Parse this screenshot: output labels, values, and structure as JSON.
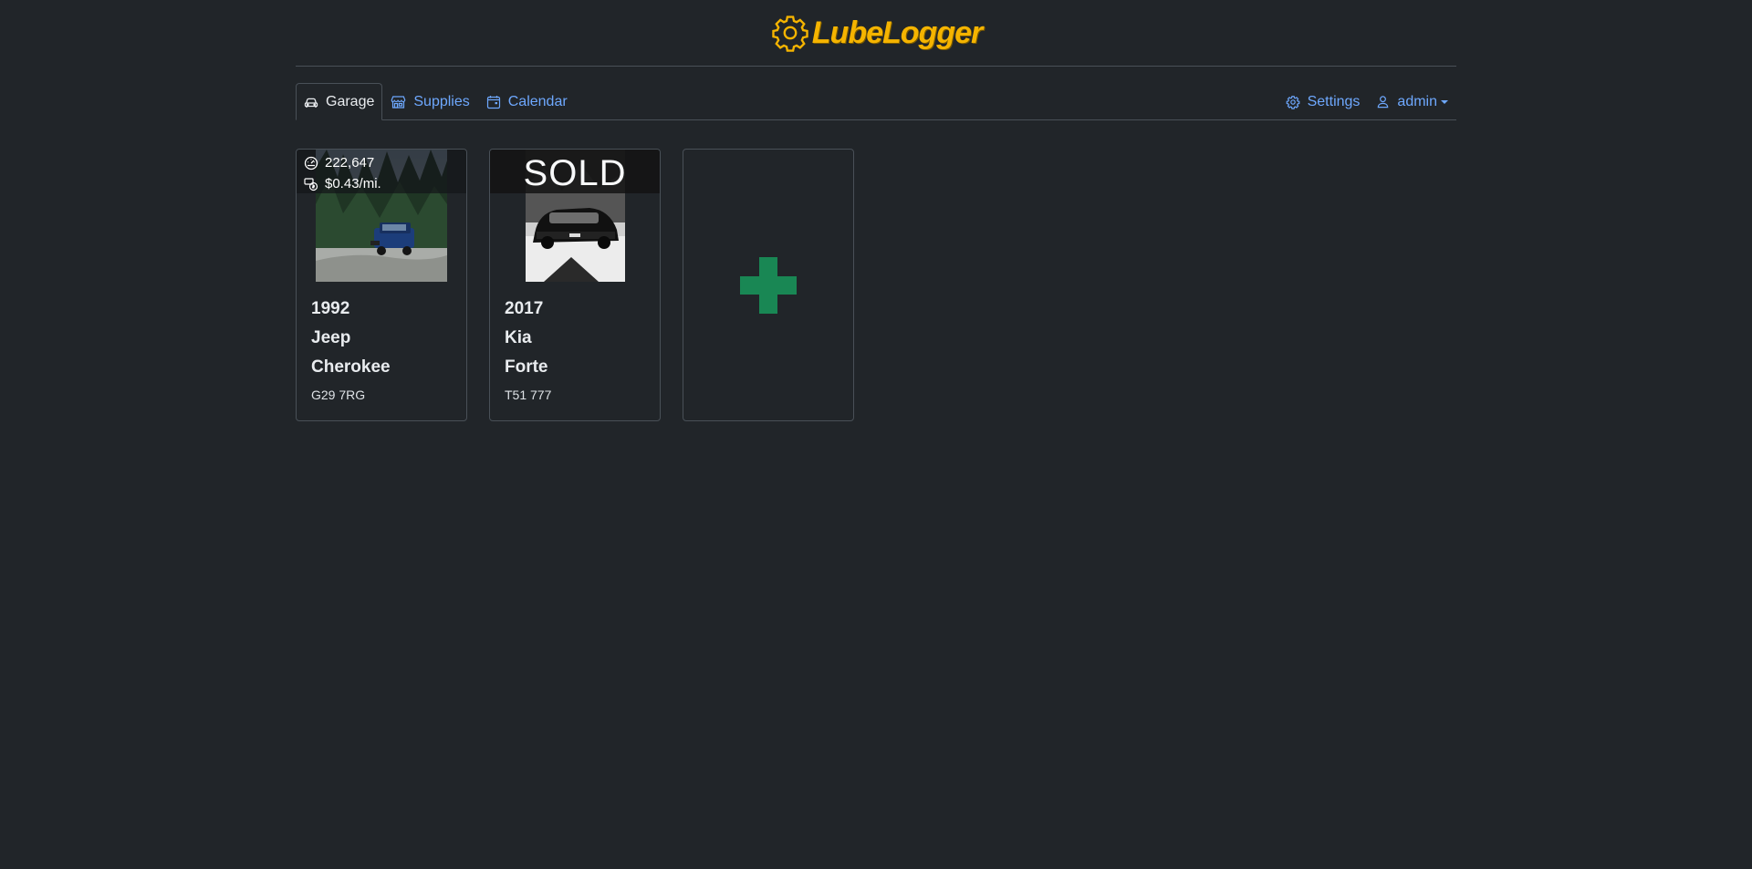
{
  "app": {
    "brand_text": "LubeLogger",
    "brand_color": "#f5b400"
  },
  "nav": {
    "left": [
      {
        "label": "Garage",
        "icon": "car-icon",
        "active": true
      },
      {
        "label": "Supplies",
        "icon": "shop-icon",
        "active": false
      },
      {
        "label": "Calendar",
        "icon": "calendar-icon",
        "active": false
      }
    ],
    "right": [
      {
        "label": "Settings",
        "icon": "gear-icon"
      },
      {
        "label": "admin",
        "icon": "person-icon"
      }
    ]
  },
  "vehicles": [
    {
      "year": "1992",
      "make": "Jeep",
      "model": "Cherokee",
      "plate": "G29 7RG",
      "odometer": "222,647",
      "cost_per_mile": "$0.43/mi.",
      "sold": false
    },
    {
      "year": "2017",
      "make": "Kia",
      "model": "Forte",
      "plate": "T51 777",
      "sold_label": "SOLD",
      "sold": true
    }
  ],
  "add_card": {
    "icon": "plus-icon",
    "color": "#198754"
  },
  "colors": {
    "background": "#212529",
    "link": "#6ea8fe",
    "border": "#495057"
  }
}
